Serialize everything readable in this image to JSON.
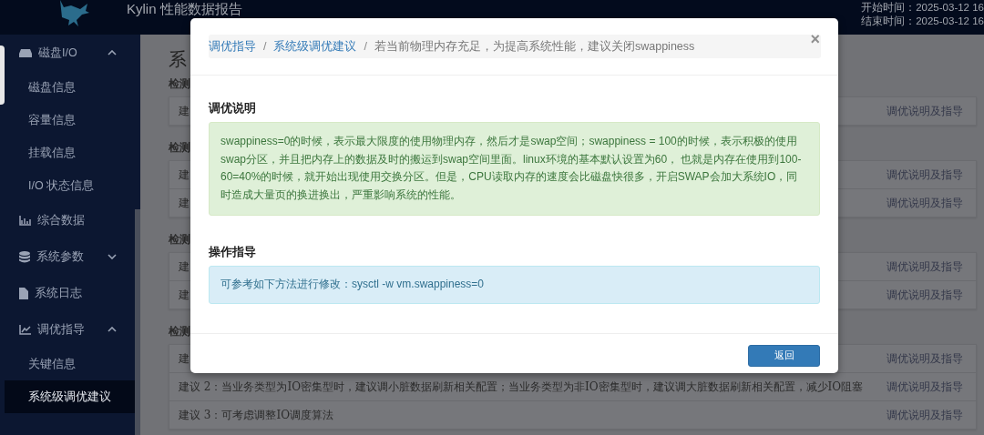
{
  "header": {
    "title": "Kylin 性能数据报告",
    "start_time": "开始时间：2025-03-12 16",
    "end_time": "结束时间：2025-03-12 16"
  },
  "sidebar": {
    "items": [
      {
        "label": "磁盘I/O",
        "expanded": true,
        "selected": false,
        "children": [
          {
            "label": "磁盘信息",
            "selected": false
          },
          {
            "label": "容量信息",
            "selected": false
          },
          {
            "label": "挂载信息",
            "selected": false
          },
          {
            "label": "I/O 状态信息",
            "selected": false
          }
        ]
      },
      {
        "label": "综合数据",
        "selected": false
      },
      {
        "label": "系统参数",
        "expanded": false,
        "selected": false
      },
      {
        "label": "系统日志",
        "selected": false
      },
      {
        "label": "调优指导",
        "expanded": true,
        "selected": false,
        "children": [
          {
            "label": "关键信息",
            "selected": false
          },
          {
            "label": "系统级调优建议",
            "selected": true
          }
        ]
      }
    ]
  },
  "main": {
    "heading": "系",
    "sections": [
      {
        "label": "检测",
        "rows": [
          {
            "text": "建",
            "link": "调优说明及指导"
          }
        ]
      },
      {
        "label": "检测",
        "rows": [
          {
            "text": "建",
            "link": "调优说明及指导"
          },
          {
            "text": "建",
            "link": "调优说明及指导"
          }
        ]
      },
      {
        "label": "检测",
        "rows": [
          {
            "text": "建",
            "link": "调优说明及指导"
          },
          {
            "text": "建",
            "link": "调优说明及指导"
          }
        ]
      },
      {
        "label": "检测",
        "rows": [
          {
            "text": "建",
            "link": "调优说明及指导"
          },
          {
            "text": "建议 2：当业务类型为IO密集型时，建议调小脏数据刷新相关配置；当业务类型为非IO密集型时，建议调大脏数据刷新相关配置，减少IO阻塞",
            "link": "调优说明及指导"
          },
          {
            "text": "建议 3：可考虑调整IO调度算法",
            "link": "调优说明及指导"
          }
        ]
      }
    ]
  },
  "modal": {
    "separator": "/",
    "breadcrumb": [
      {
        "label": "调优指导",
        "kind": "link"
      },
      {
        "label": "系统级调优建议",
        "kind": "link"
      },
      {
        "label": "若当前物理内存充足，为提高系统性能，建议关闭swappiness",
        "kind": "current"
      }
    ],
    "close": "×",
    "sections": [
      {
        "title": "调优说明",
        "kind": "success",
        "text": "swappiness=0的时候，表示最大限度的使用物理内存，然后才是swap空间；swappiness = 100的时候，表示积极的使用swap分区，并且把内存上的数据及时的搬运到swap空间里面。linux环境的基本默认设置为60， 也就是内存在使用到100-60=40%的时候，就开始出现使用交换分区。但是，CPU读取内存的速度会比磁盘快很多，开启SWAP会加大系统IO，同时造成大量页的换进换出，严重影响系统的性能。"
      },
      {
        "title": "操作指导",
        "kind": "info",
        "text": "可参考如下方法进行修改：sysctl -w vm.swappiness=0"
      }
    ],
    "button": "返回"
  }
}
